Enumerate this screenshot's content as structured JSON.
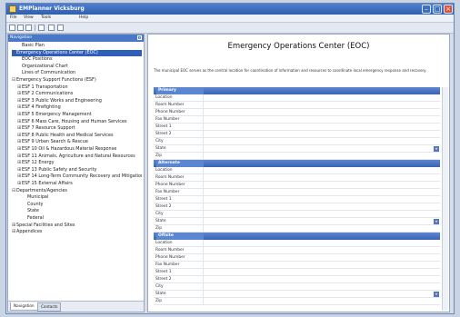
{
  "window": {
    "title": "EMPlanner Vicksburg"
  },
  "menubar": [
    "File",
    "View",
    "Tools",
    "Help"
  ],
  "toolbar": {
    "icons": [
      "new-icon",
      "open-icon",
      "save-icon",
      "print-icon",
      "cut-icon",
      "pin-icon"
    ]
  },
  "navigation": {
    "header": "Navigation",
    "tree": [
      {
        "label": "Basic Plan",
        "level": 1
      },
      {
        "label": "Emergency Operations Center (EOC)",
        "level": 0,
        "expander": "⊟",
        "selected": true
      },
      {
        "label": "EOC Positions",
        "level": 1
      },
      {
        "label": "Organizational Chart",
        "level": 1
      },
      {
        "label": "Lines of Communication",
        "level": 1
      },
      {
        "label": "Emergency Support Functions (ESF)",
        "level": 0,
        "expander": "⊟"
      },
      {
        "label": "ESF 1 Transportation",
        "level": 1,
        "expander": "⊞"
      },
      {
        "label": "ESF 2 Communications",
        "level": 1,
        "expander": "⊞"
      },
      {
        "label": "ESF 3 Public Works and Engineering",
        "level": 1,
        "expander": "⊞"
      },
      {
        "label": "ESF 4 Firefighting",
        "level": 1,
        "expander": "⊞"
      },
      {
        "label": "ESF 5 Emergency Management",
        "level": 1,
        "expander": "⊞"
      },
      {
        "label": "ESF 6 Mass Care, Housing and Human Services",
        "level": 1,
        "expander": "⊞"
      },
      {
        "label": "ESF 7 Resource Support",
        "level": 1,
        "expander": "⊞"
      },
      {
        "label": "ESF 8 Public Health and Medical Services",
        "level": 1,
        "expander": "⊞"
      },
      {
        "label": "ESF 9 Urban Search & Rescue",
        "level": 1,
        "expander": "⊞"
      },
      {
        "label": "ESF 10 Oil & Hazardous Material Response",
        "level": 1,
        "expander": "⊞"
      },
      {
        "label": "ESF 11 Animals, Agriculture and Natural Resources",
        "level": 1,
        "expander": "⊞"
      },
      {
        "label": "ESF 12 Energy",
        "level": 1,
        "expander": "⊞"
      },
      {
        "label": "ESF 13 Public Safety and Security",
        "level": 1,
        "expander": "⊞"
      },
      {
        "label": "ESF 14 Long-Term Community Recovery and Mitigation",
        "level": 1,
        "expander": "⊞"
      },
      {
        "label": "ESF 15 External Affairs",
        "level": 1,
        "expander": "⊞"
      },
      {
        "label": "Departments/Agencies",
        "level": 0,
        "expander": "⊟"
      },
      {
        "label": "Municipal",
        "level": 2
      },
      {
        "label": "County",
        "level": 2
      },
      {
        "label": "State",
        "level": 2
      },
      {
        "label": "Federal",
        "level": 2
      },
      {
        "label": "Special Facilities and Sites",
        "level": 0,
        "expander": "⊞"
      },
      {
        "label": "Appendices",
        "level": 0,
        "expander": "⊞"
      }
    ],
    "tabs": [
      {
        "label": "Navigation",
        "active": true
      },
      {
        "label": "Contacts",
        "active": false
      }
    ]
  },
  "content": {
    "title": "Emergency Operations Center (EOC)",
    "description": "The municipal EOC serves as the central location for coordination of information and resources to coordinate local emergency response and recovery.",
    "sections": [
      {
        "header": "Primary",
        "fields": [
          "Location",
          "Room Number",
          "Phone Number",
          "Fax Number",
          "Street 1",
          "Street 2",
          "City",
          "State",
          "Zip"
        ]
      },
      {
        "header": "Alternate",
        "fields": [
          "Location",
          "Room Number",
          "Phone Number",
          "Fax Number",
          "Street 1",
          "Street 2",
          "City",
          "State",
          "Zip"
        ]
      },
      {
        "header": "Offsite",
        "fields": [
          "Location",
          "Room Number",
          "Phone Number",
          "Fax Number",
          "Street 1",
          "Street 2",
          "City",
          "State",
          "Zip"
        ]
      }
    ]
  },
  "colors": {
    "accent": "#3965b5",
    "selection": "#2f5fb8"
  }
}
